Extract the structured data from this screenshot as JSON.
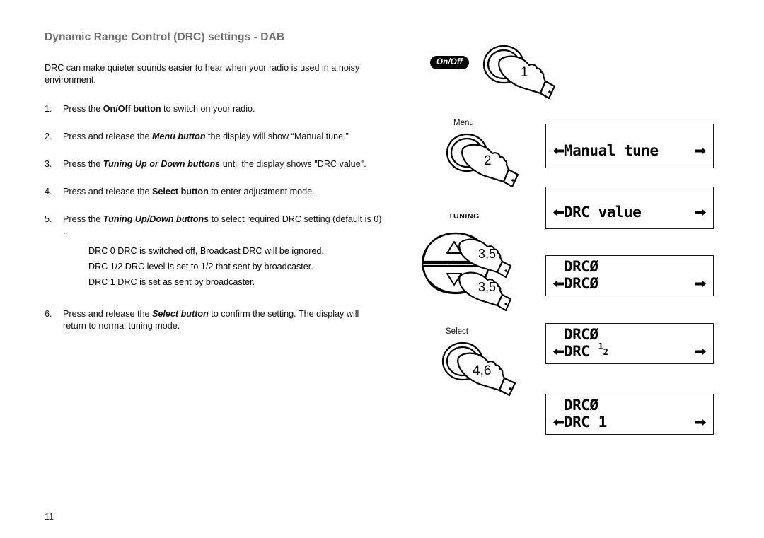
{
  "page": {
    "heading": "Dynamic Range Control (DRC) settings - DAB",
    "intro": "DRC can make quieter sounds easier to hear when your radio is used in a noisy environment.",
    "page_number": "11"
  },
  "steps": [
    {
      "num": "1.",
      "parts": [
        {
          "t": "Press the ",
          "style": "normal"
        },
        {
          "t": "On/Off button",
          "style": "bold"
        },
        {
          "t": " to switch on your radio.",
          "style": "normal"
        }
      ]
    },
    {
      "num": "2.",
      "parts": [
        {
          "t": "Press and release the ",
          "style": "normal"
        },
        {
          "t": "Menu button",
          "style": "bold-italic"
        },
        {
          "t": " the display will show “Manual tune.”",
          "style": "normal"
        }
      ]
    },
    {
      "num": "3.",
      "parts": [
        {
          "t": "Press the ",
          "style": "normal"
        },
        {
          "t": "Tuning Up or Down buttons",
          "style": "bold-italic"
        },
        {
          "t": " until the display shows \"DRC value\".",
          "style": "normal"
        }
      ]
    },
    {
      "num": "4.",
      "parts": [
        {
          "t": "Press and release the ",
          "style": "normal"
        },
        {
          "t": "Select button",
          "style": "bold"
        },
        {
          "t": " to enter adjustment mode.",
          "style": "normal"
        }
      ]
    },
    {
      "num": "5.",
      "parts": [
        {
          "t": "Press the ",
          "style": "normal"
        },
        {
          "t": "Tuning Up/Down buttons",
          "style": "bold-italic"
        },
        {
          "t": " to select required DRC setting (default is 0) .",
          "style": "normal"
        }
      ],
      "sublines": [
        "DRC 0  DRC is switched off, Broadcast DRC will be ignored.",
        "DRC 1/2 DRC level is set to 1/2 that sent by broadcaster.",
        "DRC 1  DRC is set as sent by broadcaster."
      ]
    },
    {
      "num": "6.",
      "parts": [
        {
          "t": "Press and release the ",
          "style": "normal"
        },
        {
          "t": "Select button",
          "style": "bold-italic"
        },
        {
          "t": " to confirm the setting. The display will return to normal tuning mode.",
          "style": "normal"
        }
      ]
    }
  ],
  "controls": [
    {
      "name": "onoff",
      "label": "On/Off",
      "badge": true,
      "hand_number": "1"
    },
    {
      "name": "menu",
      "label": "Menu",
      "badge": false,
      "hand_number": "2"
    },
    {
      "name": "tuning",
      "label": "TUNING",
      "badge": false,
      "hand_number_up": "3,5",
      "hand_number_down": "3,5"
    },
    {
      "name": "select",
      "label": "Select",
      "badge": false,
      "hand_number": "4,6"
    }
  ],
  "displays": [
    {
      "name": "manual-tune",
      "line1": "",
      "line2": "Manual tune",
      "left_arrow": true,
      "right_arrow": true,
      "fraction": false
    },
    {
      "name": "drc-value",
      "line1": "",
      "line2": "DRC value",
      "left_arrow": true,
      "right_arrow": true,
      "fraction": false
    },
    {
      "name": "drc-0",
      "line1": "DRCØ",
      "line2": "DRCØ",
      "left_arrow": true,
      "right_arrow": true,
      "fraction": false
    },
    {
      "name": "drc-half",
      "line1": "DRCØ",
      "line2": "DRC ",
      "left_arrow": true,
      "right_arrow": true,
      "fraction": true,
      "frac_num": "1",
      "frac_den": "2"
    },
    {
      "name": "drc-1",
      "line1": "DRCØ",
      "line2": "DRC 1",
      "left_arrow": true,
      "right_arrow": true,
      "fraction": false
    }
  ],
  "colors": {
    "heading": "#6d6d6d",
    "body": "#111111",
    "lcd_border": "#1a1a1a",
    "badge_bg": "#000000"
  }
}
